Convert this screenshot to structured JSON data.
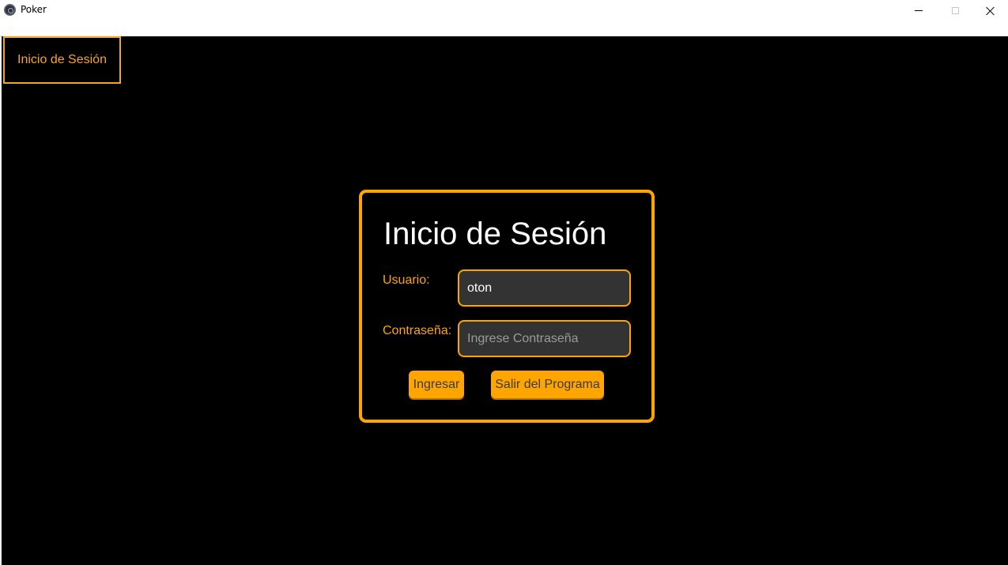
{
  "window": {
    "title": "Poker",
    "controls": [
      "minimize-icon",
      "maximize-icon",
      "close-icon"
    ]
  },
  "nav": {
    "tab_label": "Inicio de Sesión"
  },
  "login": {
    "title": "Inicio de Sesión",
    "username_label": "Usuario:",
    "username_value": "oton",
    "password_label": "Contraseña:",
    "password_placeholder": "Ingrese Contraseña",
    "password_value": "",
    "login_button": "Ingresar",
    "exit_button": "Salir del Programa"
  },
  "colors": {
    "accent": "#ffa500",
    "background": "#000000",
    "input_bg": "#333333"
  }
}
